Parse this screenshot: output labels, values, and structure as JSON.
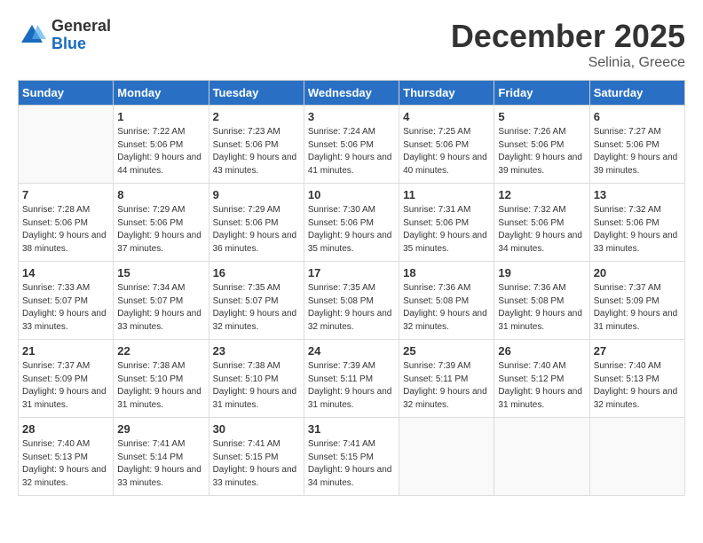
{
  "header": {
    "logo_general": "General",
    "logo_blue": "Blue",
    "month_title": "December 2025",
    "location": "Selinia, Greece"
  },
  "weekdays": [
    "Sunday",
    "Monday",
    "Tuesday",
    "Wednesday",
    "Thursday",
    "Friday",
    "Saturday"
  ],
  "weeks": [
    [
      {
        "day": "",
        "info": ""
      },
      {
        "day": "1",
        "info": "Sunrise: 7:22 AM\nSunset: 5:06 PM\nDaylight: 9 hours\nand 44 minutes."
      },
      {
        "day": "2",
        "info": "Sunrise: 7:23 AM\nSunset: 5:06 PM\nDaylight: 9 hours\nand 43 minutes."
      },
      {
        "day": "3",
        "info": "Sunrise: 7:24 AM\nSunset: 5:06 PM\nDaylight: 9 hours\nand 41 minutes."
      },
      {
        "day": "4",
        "info": "Sunrise: 7:25 AM\nSunset: 5:06 PM\nDaylight: 9 hours\nand 40 minutes."
      },
      {
        "day": "5",
        "info": "Sunrise: 7:26 AM\nSunset: 5:06 PM\nDaylight: 9 hours\nand 39 minutes."
      },
      {
        "day": "6",
        "info": "Sunrise: 7:27 AM\nSunset: 5:06 PM\nDaylight: 9 hours\nand 39 minutes."
      }
    ],
    [
      {
        "day": "7",
        "info": "Sunrise: 7:28 AM\nSunset: 5:06 PM\nDaylight: 9 hours\nand 38 minutes."
      },
      {
        "day": "8",
        "info": "Sunrise: 7:29 AM\nSunset: 5:06 PM\nDaylight: 9 hours\nand 37 minutes."
      },
      {
        "day": "9",
        "info": "Sunrise: 7:29 AM\nSunset: 5:06 PM\nDaylight: 9 hours\nand 36 minutes."
      },
      {
        "day": "10",
        "info": "Sunrise: 7:30 AM\nSunset: 5:06 PM\nDaylight: 9 hours\nand 35 minutes."
      },
      {
        "day": "11",
        "info": "Sunrise: 7:31 AM\nSunset: 5:06 PM\nDaylight: 9 hours\nand 35 minutes."
      },
      {
        "day": "12",
        "info": "Sunrise: 7:32 AM\nSunset: 5:06 PM\nDaylight: 9 hours\nand 34 minutes."
      },
      {
        "day": "13",
        "info": "Sunrise: 7:32 AM\nSunset: 5:06 PM\nDaylight: 9 hours\nand 33 minutes."
      }
    ],
    [
      {
        "day": "14",
        "info": "Sunrise: 7:33 AM\nSunset: 5:07 PM\nDaylight: 9 hours\nand 33 minutes."
      },
      {
        "day": "15",
        "info": "Sunrise: 7:34 AM\nSunset: 5:07 PM\nDaylight: 9 hours\nand 33 minutes."
      },
      {
        "day": "16",
        "info": "Sunrise: 7:35 AM\nSunset: 5:07 PM\nDaylight: 9 hours\nand 32 minutes."
      },
      {
        "day": "17",
        "info": "Sunrise: 7:35 AM\nSunset: 5:08 PM\nDaylight: 9 hours\nand 32 minutes."
      },
      {
        "day": "18",
        "info": "Sunrise: 7:36 AM\nSunset: 5:08 PM\nDaylight: 9 hours\nand 32 minutes."
      },
      {
        "day": "19",
        "info": "Sunrise: 7:36 AM\nSunset: 5:08 PM\nDaylight: 9 hours\nand 31 minutes."
      },
      {
        "day": "20",
        "info": "Sunrise: 7:37 AM\nSunset: 5:09 PM\nDaylight: 9 hours\nand 31 minutes."
      }
    ],
    [
      {
        "day": "21",
        "info": "Sunrise: 7:37 AM\nSunset: 5:09 PM\nDaylight: 9 hours\nand 31 minutes."
      },
      {
        "day": "22",
        "info": "Sunrise: 7:38 AM\nSunset: 5:10 PM\nDaylight: 9 hours\nand 31 minutes."
      },
      {
        "day": "23",
        "info": "Sunrise: 7:38 AM\nSunset: 5:10 PM\nDaylight: 9 hours\nand 31 minutes."
      },
      {
        "day": "24",
        "info": "Sunrise: 7:39 AM\nSunset: 5:11 PM\nDaylight: 9 hours\nand 31 minutes."
      },
      {
        "day": "25",
        "info": "Sunrise: 7:39 AM\nSunset: 5:11 PM\nDaylight: 9 hours\nand 32 minutes."
      },
      {
        "day": "26",
        "info": "Sunrise: 7:40 AM\nSunset: 5:12 PM\nDaylight: 9 hours\nand 31 minutes."
      },
      {
        "day": "27",
        "info": "Sunrise: 7:40 AM\nSunset: 5:13 PM\nDaylight: 9 hours\nand 32 minutes."
      }
    ],
    [
      {
        "day": "28",
        "info": "Sunrise: 7:40 AM\nSunset: 5:13 PM\nDaylight: 9 hours\nand 32 minutes."
      },
      {
        "day": "29",
        "info": "Sunrise: 7:41 AM\nSunset: 5:14 PM\nDaylight: 9 hours\nand 33 minutes."
      },
      {
        "day": "30",
        "info": "Sunrise: 7:41 AM\nSunset: 5:15 PM\nDaylight: 9 hours\nand 33 minutes."
      },
      {
        "day": "31",
        "info": "Sunrise: 7:41 AM\nSunset: 5:15 PM\nDaylight: 9 hours\nand 34 minutes."
      },
      {
        "day": "",
        "info": ""
      },
      {
        "day": "",
        "info": ""
      },
      {
        "day": "",
        "info": ""
      }
    ]
  ]
}
